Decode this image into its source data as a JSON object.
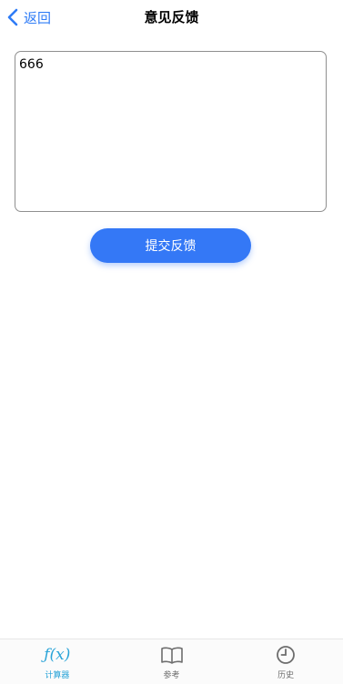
{
  "nav": {
    "back_label": "返回",
    "title": "意见反馈"
  },
  "feedback": {
    "value": "666"
  },
  "submit_label": "提交反馈",
  "tabs": [
    {
      "label": "计算器",
      "icon": "function-icon",
      "active": true
    },
    {
      "label": "参考",
      "icon": "book-icon",
      "active": false
    },
    {
      "label": "历史",
      "icon": "clock-icon",
      "active": false
    }
  ],
  "colors": {
    "accent": "#3478f6",
    "tab_active": "#2aa4d8",
    "tab_inactive": "#6d6d6d"
  }
}
